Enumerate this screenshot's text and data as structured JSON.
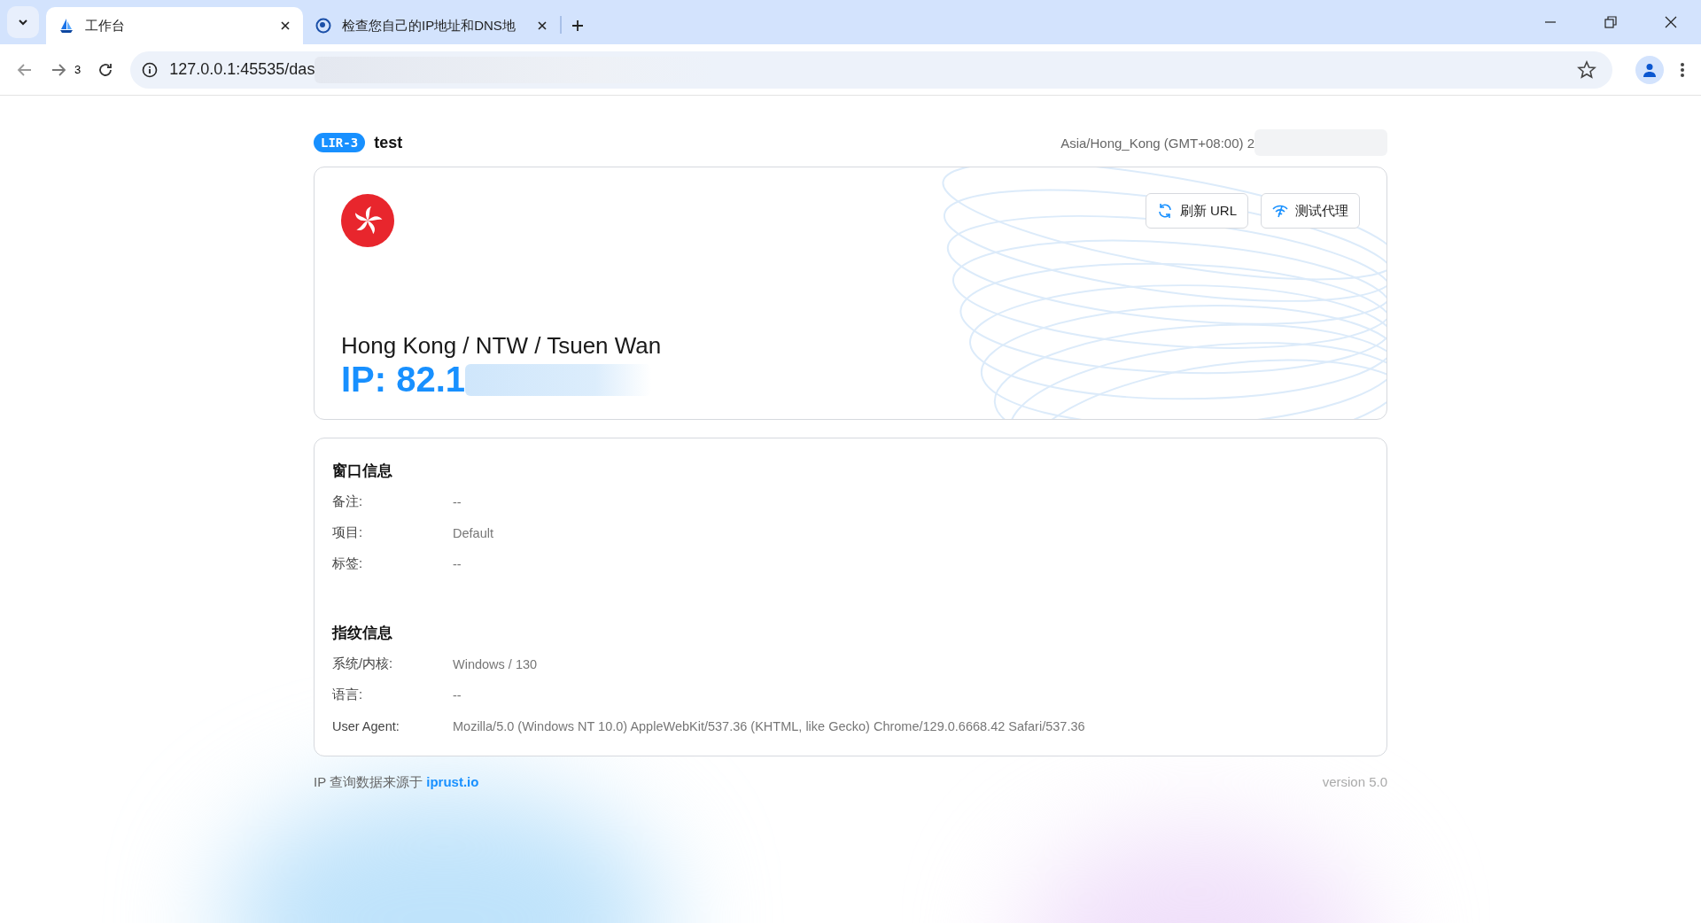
{
  "browser": {
    "tabs": [
      {
        "title": "工作台",
        "selected": true
      },
      {
        "title": "检查您自己的IP地址和DNS地",
        "selected": false
      }
    ],
    "history_count": "3",
    "url": "127.0.0.1:45535/das"
  },
  "header": {
    "badge": "LIR-3",
    "name": "test",
    "timezone": "Asia/Hong_Kong (GMT+08:00) 2"
  },
  "location_card": {
    "location": "Hong Kong / NTW / Tsuen Wan",
    "ip": "IP: 82.1",
    "buttons": [
      {
        "label": "刷新 URL"
      },
      {
        "label": "测试代理"
      }
    ]
  },
  "sections": [
    {
      "title": "窗口信息",
      "rows": [
        {
          "label": "备注:",
          "value": "--"
        },
        {
          "label": "项目:",
          "value": "Default"
        },
        {
          "label": "标签:",
          "value": "--"
        }
      ]
    },
    {
      "title": "指纹信息",
      "rows": [
        {
          "label": "系统/内核:",
          "value": "Windows / 130"
        },
        {
          "label": "语言:",
          "value": "--"
        },
        {
          "label": "User Agent:",
          "value": "Mozilla/5.0 (Windows NT 10.0) AppleWebKit/537.36 (KHTML, like Gecko) Chrome/129.0.6668.42 Safari/537.36"
        }
      ]
    }
  ],
  "footer": {
    "source_text": "IP 查询数据来源于",
    "source_link": "iprust.io",
    "version": "version 5.0"
  }
}
